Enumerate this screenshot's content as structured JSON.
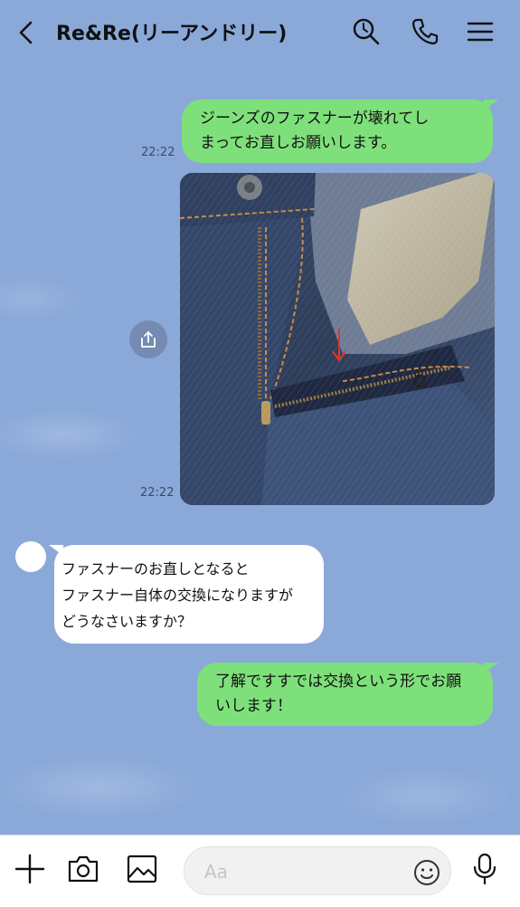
{
  "header": {
    "title": "Re&Re(リーアンドリー)",
    "back_icon": "chevron-left-icon",
    "search_icon": "search-icon",
    "call_icon": "phone-icon",
    "menu_icon": "menu-icon"
  },
  "messages": [
    {
      "side": "right",
      "text_lines": [
        "ジーンズのファスナーが壊れてし",
        "まってお直しお願いします。"
      ],
      "time": "22:22"
    },
    {
      "side": "right",
      "type": "photo",
      "time": "22:22"
    },
    {
      "side": "left",
      "text_lines": [
        "ファスナーのお直しとなると",
        "ファスナー自体の交換になりますが",
        "どうなさいますか？"
      ]
    },
    {
      "side": "right",
      "text_lines": [
        "了解ですすでは交換という形でお願",
        "いします！"
      ]
    }
  ],
  "input": {
    "placeholder": "Aa"
  },
  "colors": {
    "background": "#8aa9d9",
    "bubble_mine": "#7ee07a",
    "bubble_theirs": "#ffffff"
  }
}
